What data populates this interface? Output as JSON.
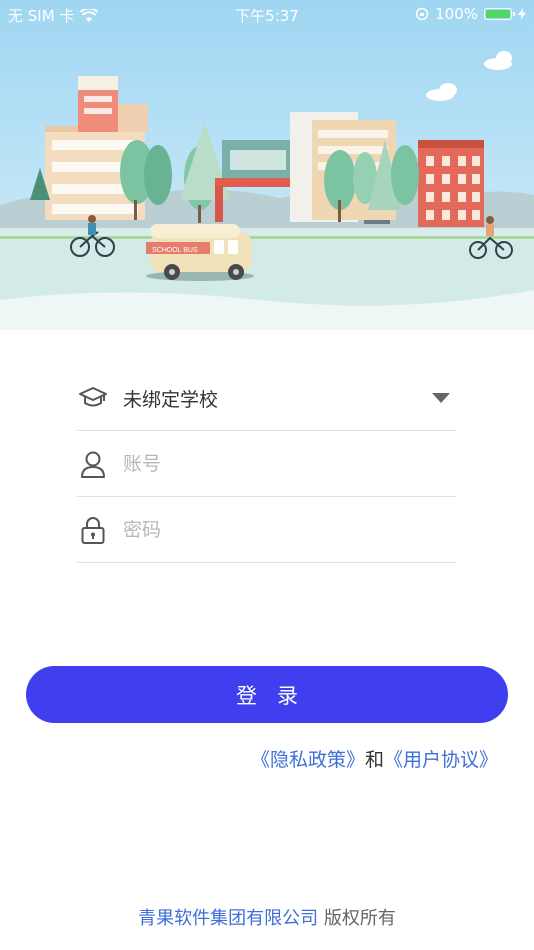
{
  "status_bar": {
    "carrier": "无 SIM 卡",
    "time": "下午5:37",
    "battery_percent": "100%",
    "battery_level": 1.0
  },
  "hero": {
    "bus_label": "SCHOOL BUS"
  },
  "form": {
    "school": {
      "value": "未绑定学校",
      "icon": "graduation-cap-icon"
    },
    "account": {
      "placeholder": "账号",
      "icon": "user-icon"
    },
    "password": {
      "placeholder": "密码",
      "icon": "lock-icon"
    }
  },
  "login_button": {
    "label": "登录"
  },
  "agreement": {
    "privacy_link": "《隐私政策》",
    "conjunction": "和",
    "user_agreement_link": "《用户协议》"
  },
  "footer": {
    "company": "青果软件集团有限公司",
    "rights": "版权所有"
  },
  "colors": {
    "primary": "#3f3ff0",
    "link": "#3f6fd8",
    "sky": "#a9dcf4",
    "ground": "#d8ede9"
  }
}
